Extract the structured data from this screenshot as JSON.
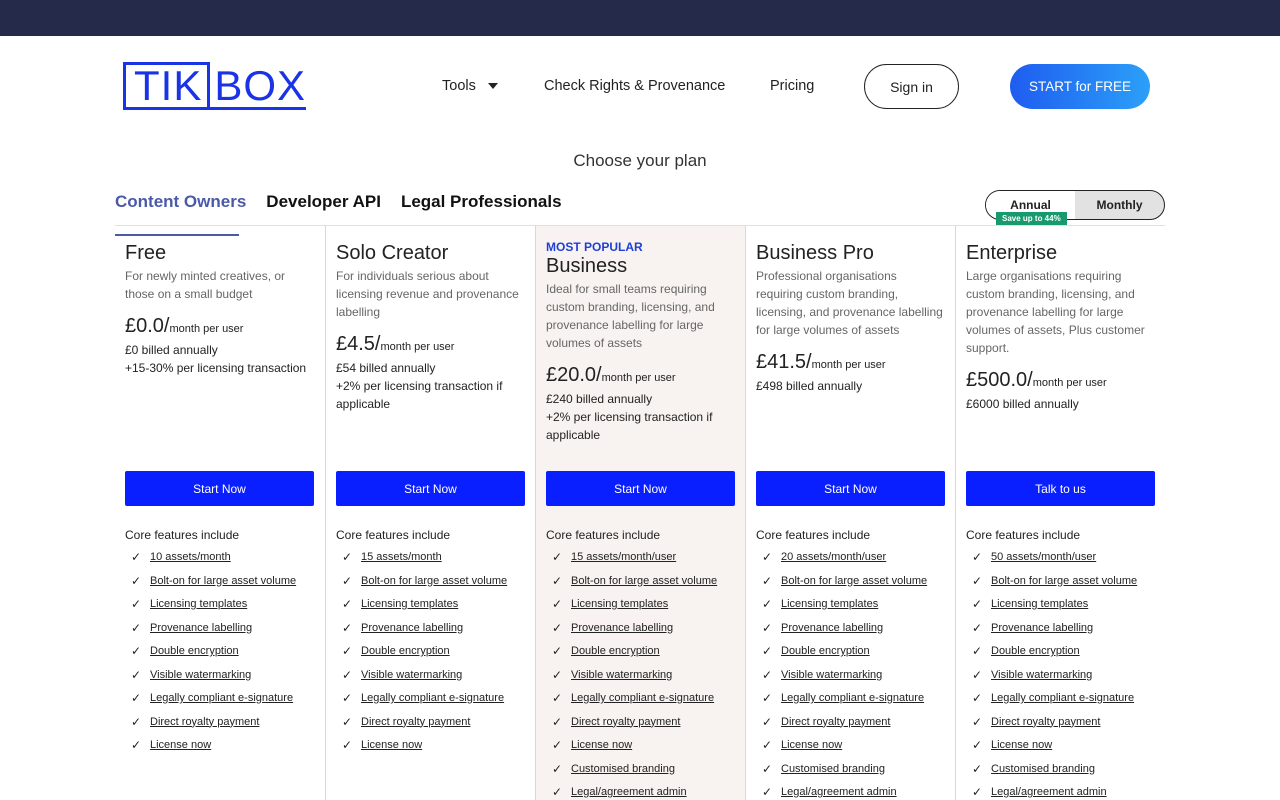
{
  "header": {
    "logo_box": "TIK",
    "logo_rest": "BOX",
    "nav": {
      "tools": "Tools",
      "check": "Check Rights & Provenance",
      "pricing": "Pricing"
    },
    "signin": "Sign in",
    "start_free": "START for FREE"
  },
  "choose_title": "Choose your plan",
  "tabs": [
    "Content Owners",
    "Developer API",
    "Legal Professionals"
  ],
  "billing_toggle": {
    "annual": "Annual",
    "monthly": "Monthly",
    "badge": "Save up to 44%",
    "selected": "Annual"
  },
  "plans": [
    {
      "name": "Free",
      "desc": "For newly minted creatives, or those on a small budget",
      "price": "£0.0/",
      "unit": "month per user",
      "billed": "£0 billed annually",
      "extra": "+15-30% per licensing transaction",
      "cta": "Start Now",
      "core": "Core features include",
      "features": [
        "10 assets/month",
        "Bolt-on for large asset volume",
        "Licensing templates",
        "Provenance labelling",
        "Double encryption",
        "Visible watermarking",
        "Legally compliant e-signature",
        "Direct royalty payment",
        "License now"
      ]
    },
    {
      "name": "Solo Creator",
      "desc": "For individuals serious about licensing revenue and provenance labelling",
      "price": "£4.5/",
      "unit": "month per user",
      "billed": "£54 billed annually",
      "extra": "+2% per licensing transaction if applicable",
      "cta": "Start Now",
      "core": "Core features include",
      "features": [
        "15 assets/month",
        "Bolt-on for large asset volume",
        "Licensing templates",
        "Provenance labelling",
        "Double encryption",
        "Visible watermarking",
        "Legally compliant e-signature",
        "Direct royalty payment",
        "License now"
      ]
    },
    {
      "popular": "MOST POPULAR",
      "name": "Business",
      "desc": "Ideal for small teams requiring custom branding, licensing, and provenance labelling for large volumes of assets",
      "price": "£20.0/",
      "unit": "month per user",
      "billed": "£240 billed annually",
      "extra": "+2% per licensing transaction if applicable",
      "cta": "Start Now",
      "core": "Core features include",
      "features": [
        "15 assets/month/user",
        "Bolt-on for large asset volume",
        "Licensing templates",
        "Provenance labelling",
        "Double encryption",
        "Visible watermarking",
        "Legally compliant e-signature",
        "Direct royalty payment",
        "License now",
        "Customised branding",
        "Legal/agreement admin"
      ]
    },
    {
      "name": "Business Pro",
      "desc": "Professional organisations requiring custom branding, licensing, and provenance labelling for large volumes of assets",
      "price": "£41.5/",
      "unit": "month per user",
      "billed": "£498 billed annually",
      "cta": "Start Now",
      "core": "Core features include",
      "features": [
        "20 assets/month/user",
        "Bolt-on for large asset volume",
        "Licensing templates",
        "Provenance labelling",
        "Double encryption",
        "Visible watermarking",
        "Legally compliant e-signature",
        "Direct royalty payment",
        "License now",
        "Customised branding",
        "Legal/agreement admin"
      ]
    },
    {
      "name": "Enterprise",
      "desc": "Large organisations requiring custom branding, licensing, and provenance labelling for large volumes of assets, Plus customer support.",
      "price": "£500.0/",
      "unit": "month per user",
      "billed": "£6000 billed annually",
      "cta": "Talk to us",
      "core": "Core features include",
      "features": [
        "50 assets/month/user",
        "Bolt-on for large asset volume",
        "Licensing templates",
        "Provenance labelling",
        "Double encryption",
        "Visible watermarking",
        "Legally compliant e-signature",
        "Direct royalty payment",
        "License now",
        "Customised branding",
        "Legal/agreement admin"
      ]
    }
  ],
  "check_glyph": "✓"
}
